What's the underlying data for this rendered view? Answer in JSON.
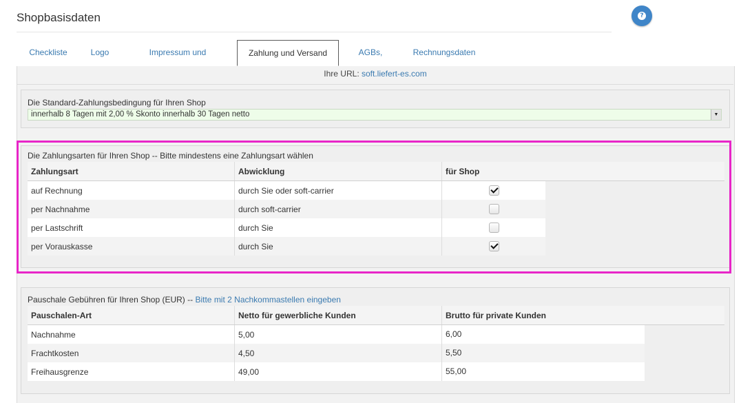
{
  "header": {
    "title": "Shopbasisdaten",
    "help_icon": "question-circle-icon"
  },
  "tabs": [
    {
      "label": "Checkliste",
      "active": false
    },
    {
      "label": "Logo",
      "active": false
    },
    {
      "label": "Impressum und Shoptyp",
      "active": false
    },
    {
      "label": "Zahlung und Versand",
      "active": true
    },
    {
      "label": "AGBs, etc",
      "active": false
    },
    {
      "label": "Rechnungsdaten",
      "active": false
    }
  ],
  "url_line": {
    "label": "Ihre URL:",
    "link": "soft.liefert-es.com"
  },
  "payment_terms": {
    "label": "Die Standard-Zahlungsbedingung für Ihren Shop",
    "selected": "innerhalb 8 Tagen mit 2,00 % Skonto innerhalb 30 Tagen netto"
  },
  "payment_methods": {
    "label": "Die Zahlungsarten für Ihren Shop -- Bitte mindestens eine Zahlungsart wählen",
    "columns": [
      "Zahlungsart",
      "Abwicklung",
      "für Shop"
    ],
    "rows": [
      {
        "method": "auf Rechnung",
        "handling": "durch Sie oder soft-carrier",
        "checked": true
      },
      {
        "method": "per Nachnahme",
        "handling": "durch soft-carrier",
        "checked": false
      },
      {
        "method": "per Lastschrift",
        "handling": "durch Sie",
        "checked": false
      },
      {
        "method": "per Vorauskasse",
        "handling": "durch Sie",
        "checked": true
      }
    ]
  },
  "fees": {
    "label": "Pauschale Gebühren für Ihren Shop (EUR) --",
    "hint": "Bitte mit 2 Nachkommastellen eingeben",
    "columns": [
      "Pauschalen-Art",
      "Netto für gewerbliche Kunden",
      "Brutto für private Kunden"
    ],
    "rows": [
      {
        "type": "Nachnahme",
        "net": "5,00",
        "gross": "6,00"
      },
      {
        "type": "Frachtkosten",
        "net": "4,50",
        "gross": "5,50"
      },
      {
        "type": "Freihausgrenze",
        "net": "49,00",
        "gross": "55,00"
      }
    ]
  },
  "colors": {
    "accent": "#3a7ab0",
    "highlight": "#e825c8",
    "help": "#3f85c8",
    "select_bg": "#eefde9"
  }
}
